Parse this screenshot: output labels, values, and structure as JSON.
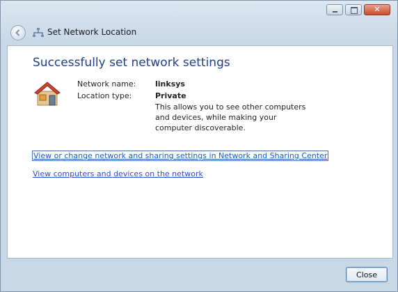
{
  "window": {
    "title": "Set Network Location",
    "caption_buttons": [
      "minimize-icon",
      "maximize-icon",
      "close-icon"
    ],
    "close_glyph": "✕"
  },
  "content": {
    "heading": "Successfully set network settings",
    "network_name_label": "Network name:",
    "network_name_value": "linksys",
    "location_type_label": "Location type:",
    "location_type_value": "Private",
    "description": "This allows you to see other computers and devices, while making your computer discoverable.",
    "link_sharing_center": "View or change network and sharing settings in Network and Sharing Center",
    "link_computers": "View computers and devices on the network"
  },
  "footer": {
    "close_label": "Close"
  },
  "colors": {
    "heading": "#1e3f8a",
    "link": "#1f55c4",
    "frame": "#c9d8e7"
  }
}
